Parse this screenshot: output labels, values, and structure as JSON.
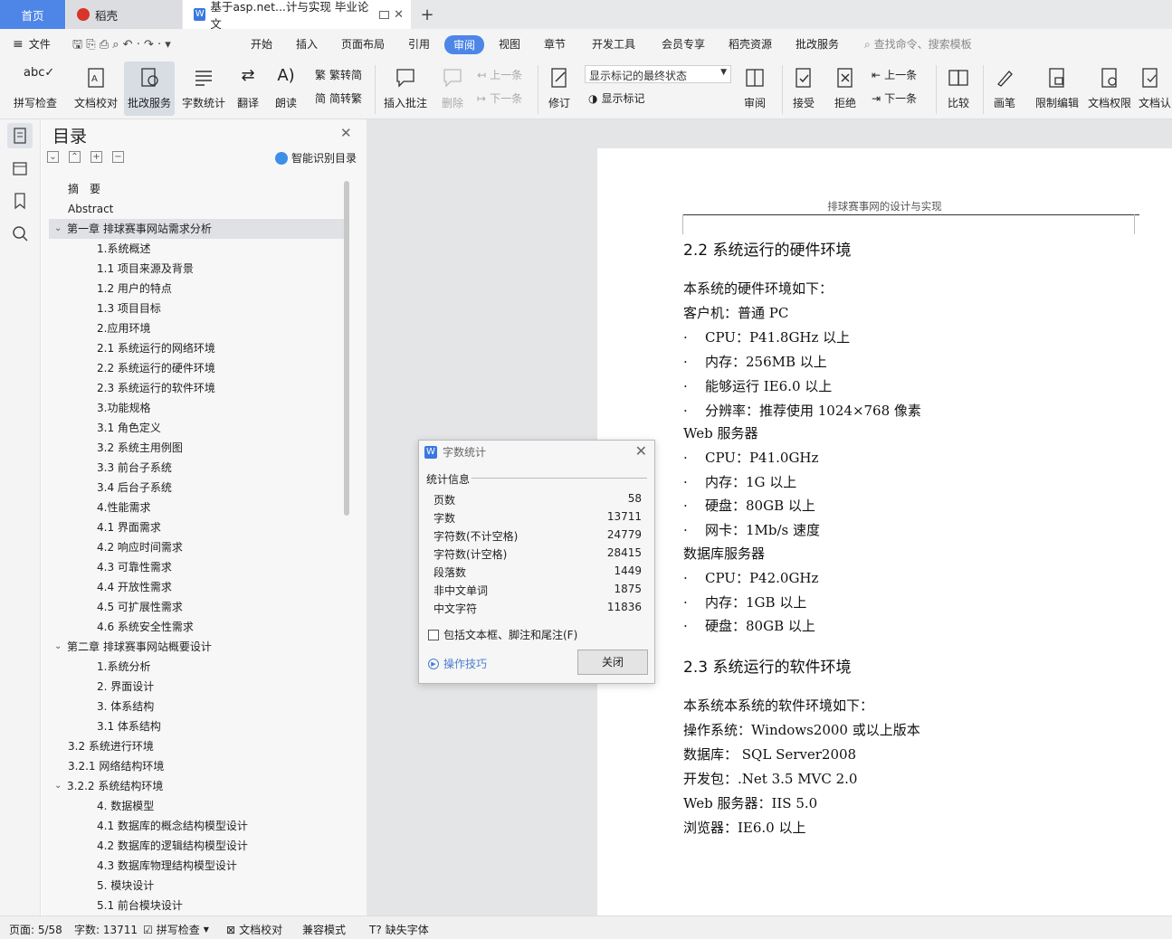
{
  "tabs": {
    "home": "首页",
    "daoke": "稻壳",
    "doc": "基于asp.net...计与实现 毕业论文",
    "plus": "+"
  },
  "menu": {
    "file": "文件",
    "items": [
      "开始",
      "插入",
      "页面布局",
      "引用",
      "审阅",
      "视图",
      "章节",
      "开发工具",
      "会员专享",
      "稻壳资源",
      "批改服务"
    ],
    "active": "审阅",
    "search": "查找命令、搜索模板"
  },
  "ribbon": {
    "spellcheck": "拼写检查",
    "doc_proof": "文档校对",
    "review_service": "批改服务",
    "word_count": "字数统计",
    "translate": "翻译",
    "read_aloud": "朗读",
    "trad_to_simp": "繁转简",
    "simp_to_trad": "简转繁",
    "insert_comment": "插入批注",
    "delete": "删除",
    "prev": "上一条",
    "next": "下一条",
    "track": "修订",
    "markup_state": "显示标记的最终状态",
    "show_markup": "显示标记",
    "review_pane": "审阅",
    "accept": "接受",
    "reject": "拒绝",
    "prev2": "上一条",
    "next2": "下一条",
    "compare": "比较",
    "pen": "画笔",
    "restrict": "限制编辑",
    "doc_rights": "文档权限",
    "doc_auth": "文档认"
  },
  "toc": {
    "title": "目录",
    "smart": "智能识别目录",
    "items": [
      {
        "label": "摘　要",
        "level": 1
      },
      {
        "label": "Abstract",
        "level": 1
      },
      {
        "label": "第一章  排球赛事网站需求分析",
        "level": 0,
        "expanded": true,
        "selected": true
      },
      {
        "label": "1.系统概述",
        "level": 2
      },
      {
        "label": "1.1  项目来源及背景",
        "level": 2
      },
      {
        "label": "1.2  用户的特点",
        "level": 2
      },
      {
        "label": "1.3  项目目标",
        "level": 2
      },
      {
        "label": "2.应用环境",
        "level": 2
      },
      {
        "label": "2.1  系统运行的网络环境",
        "level": 2
      },
      {
        "label": "2.2  系统运行的硬件环境",
        "level": 2
      },
      {
        "label": "2.3  系统运行的软件环境",
        "level": 2
      },
      {
        "label": "3.功能规格",
        "level": 2
      },
      {
        "label": "3.1  角色定义",
        "level": 2
      },
      {
        "label": "3.2  系统主用例图",
        "level": 2
      },
      {
        "label": "3.3  前台子系统",
        "level": 2
      },
      {
        "label": "3.4  后台子系统",
        "level": 2
      },
      {
        "label": "4.性能需求",
        "level": 2
      },
      {
        "label": "4.1  界面需求",
        "level": 2
      },
      {
        "label": "4.2  响应时间需求",
        "level": 2
      },
      {
        "label": "4.3  可靠性需求",
        "level": 2
      },
      {
        "label": "4.4  开放性需求",
        "level": 2
      },
      {
        "label": "4.5  可扩展性需求",
        "level": 2
      },
      {
        "label": "4.6  系统安全性需求",
        "level": 2
      },
      {
        "label": "第二章  排球赛事网站概要设计",
        "level": 0,
        "expanded": true
      },
      {
        "label": "1.系统分析",
        "level": 2
      },
      {
        "label": "2.  界面设计",
        "level": 2
      },
      {
        "label": "3.  体系结构",
        "level": 2
      },
      {
        "label": "3.1  体系结构",
        "level": 2
      },
      {
        "label": "3.2  系统进行环境",
        "level": 1
      },
      {
        "label": "3.2.1  网络结构环境",
        "level": 1
      },
      {
        "label": "3.2.2  系统结构环境",
        "level": 0,
        "expanded": true
      },
      {
        "label": "4.  数据模型",
        "level": 2
      },
      {
        "label": "4.1  数据库的概念结构模型设计",
        "level": 2
      },
      {
        "label": "4.2  数据库的逻辑结构模型设计",
        "level": 2
      },
      {
        "label": "4.3  数据库物理结构模型设计",
        "level": 2
      },
      {
        "label": "5.  模块设计",
        "level": 2
      },
      {
        "label": "5.1  前台模块设计",
        "level": 2
      }
    ]
  },
  "doc": {
    "header": "排球赛事网的设计与实现",
    "h22": "2.2  系统运行的硬件环境",
    "intro": "本系统的硬件环境如下：",
    "client": "客户机：普通 PC",
    "client_items": [
      "CPU：P41.8GHz 以上",
      "内存：256MB 以上",
      "能够运行 IE6.0 以上",
      "分辨率：推荐使用 1024×768 像素"
    ],
    "web": "Web 服务器",
    "web_items": [
      "CPU：P41.0GHz",
      "内存：1G 以上",
      "硬盘：80GB 以上",
      "网卡：1Mb/s 速度"
    ],
    "db": "数据库服务器",
    "db_items": [
      "CPU：P42.0GHz",
      "内存：1GB 以上",
      "硬盘：80GB 以上"
    ],
    "h23": "2.3  系统运行的软件环境",
    "sw_intro": "本系统本系统的软件环境如下：",
    "sw_items": [
      "操作系统：Windows2000 或以上版本",
      "数据库：  SQL Server2008",
      "开发包：.Net 3.5 MVC 2.0",
      "Web 服务器：IIS 5.0",
      "浏览器：IE6.0 以上"
    ],
    "bullet": "·"
  },
  "dialog": {
    "title": "字数统计",
    "section": "统计信息",
    "stats": [
      {
        "label": "页数",
        "value": "58"
      },
      {
        "label": "字数",
        "value": "13711"
      },
      {
        "label": "字符数(不计空格)",
        "value": "24779"
      },
      {
        "label": "字符数(计空格)",
        "value": "28415"
      },
      {
        "label": "段落数",
        "value": "1449"
      },
      {
        "label": "非中文单词",
        "value": "1875"
      },
      {
        "label": "中文字符",
        "value": "11836"
      }
    ],
    "include": "包括文本框、脚注和尾注(F)",
    "tips": "操作技巧",
    "close": "关闭"
  },
  "status": {
    "page": "页面: 5/58",
    "words": "字数: 13711",
    "spell": "拼写检查",
    "proof": "文档校对",
    "compat": "兼容模式",
    "missing_font": "缺失字体"
  },
  "colors": {
    "accent": "#4e86e8",
    "link": "#4a7ed0"
  }
}
